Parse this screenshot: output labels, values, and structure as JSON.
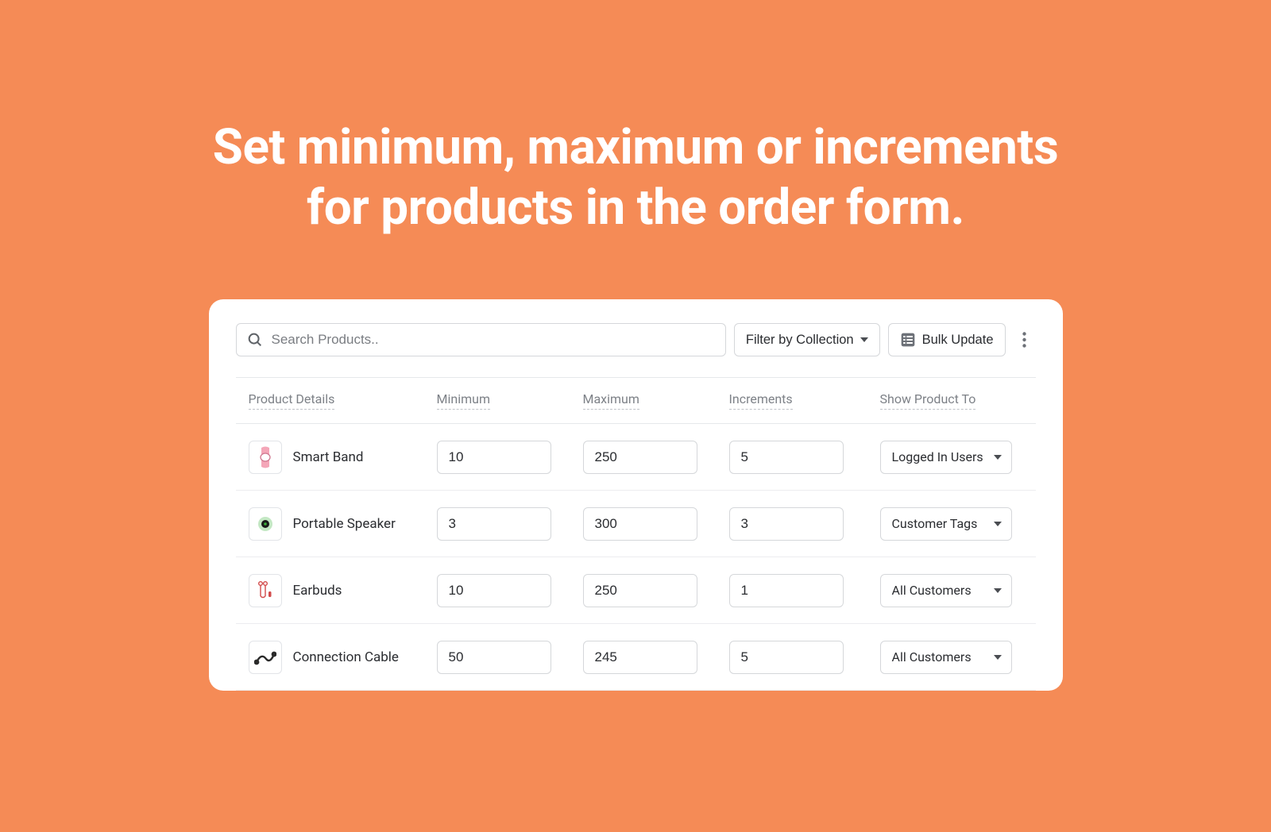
{
  "headline": {
    "line1": "Set minimum, maximum or increments",
    "line2": "for products in the order form."
  },
  "toolbar": {
    "search_placeholder": "Search Products..",
    "filter_label": "Filter by Collection",
    "bulk_label": "Bulk Update"
  },
  "columns": {
    "details": "Product Details",
    "min": "Minimum",
    "max": "Maximum",
    "inc": "Increments",
    "show": "Show Product To"
  },
  "rows": [
    {
      "name": "Smart Band",
      "min": "10",
      "max": "250",
      "inc": "5",
      "show": "Logged In Users",
      "thumb": "smart-band"
    },
    {
      "name": "Portable Speaker",
      "min": "3",
      "max": "300",
      "inc": "3",
      "show": "Customer Tags",
      "thumb": "portable-speaker"
    },
    {
      "name": "Earbuds",
      "min": "10",
      "max": "250",
      "inc": "1",
      "show": "All Customers",
      "thumb": "earbuds"
    },
    {
      "name": "Connection Cable",
      "min": "50",
      "max": "245",
      "inc": "5",
      "show": "All Customers",
      "thumb": "connection-cable"
    }
  ]
}
